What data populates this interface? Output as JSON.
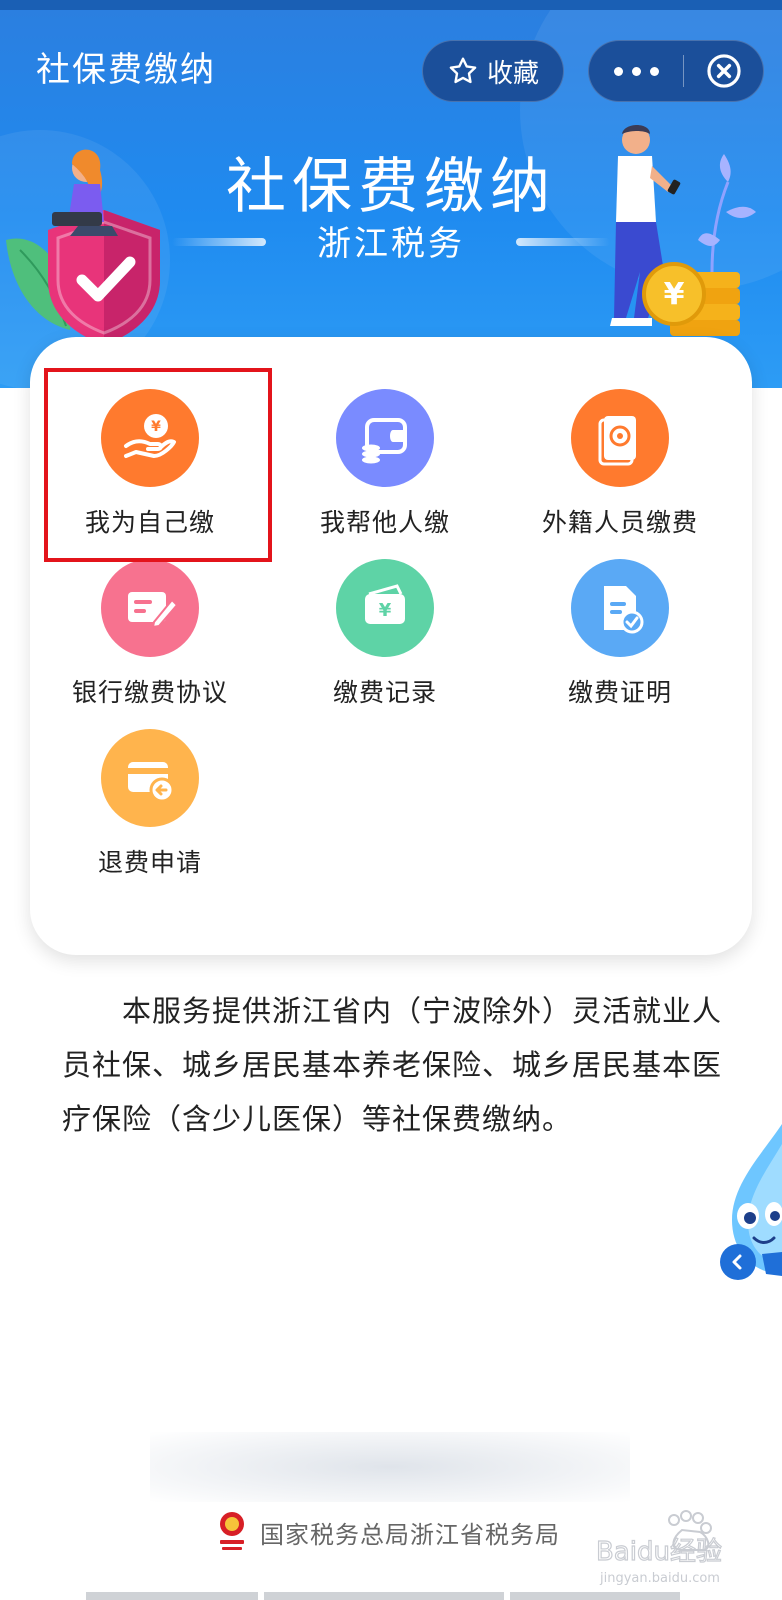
{
  "nav": {
    "title": "社保费缴纳",
    "favorite_label": "收藏",
    "favorite_icon": "star-icon",
    "more_icon": "more-dots-icon",
    "close_icon": "close-circle-icon"
  },
  "banner": {
    "title": "社保费缴纳",
    "subtitle": "浙江税务",
    "shield_icon": "shield-check-icon",
    "coin_glyph": "¥"
  },
  "services": [
    {
      "label": "我为自己缴",
      "icon": "hand-coin-icon",
      "color": "#ff7a2e"
    },
    {
      "label": "我帮他人缴",
      "icon": "wallet-coins-icon",
      "color": "#7a8bff"
    },
    {
      "label": "外籍人员缴费",
      "icon": "passport-icon",
      "color": "#ff7a2e"
    },
    {
      "label": "银行缴费协议",
      "icon": "agreement-edit-icon",
      "color": "#f7728f"
    },
    {
      "label": "缴费记录",
      "icon": "payment-record-icon",
      "color": "#5ed3a6"
    },
    {
      "label": "缴费证明",
      "icon": "certificate-check-icon",
      "color": "#5aa9f5"
    },
    {
      "label": "退费申请",
      "icon": "refund-card-icon",
      "color": "#ffb44d"
    }
  ],
  "highlight_color": "#e3141b",
  "description": "本服务提供浙江省内（宁波除外）灵活就业人员社保、城乡居民基本养老保险、城乡居民基本医疗保险（含少儿医保）等社保费缴纳。",
  "footer": {
    "org": "国家税务总局浙江省税务局",
    "emblem_icon": "tax-emblem-icon"
  },
  "watermark": {
    "brand": "Baidu经验",
    "url": "jingyan.baidu.com"
  },
  "colors": {
    "primary": "#2b7fe0",
    "nav_button_bg": "#1b4f9a"
  }
}
